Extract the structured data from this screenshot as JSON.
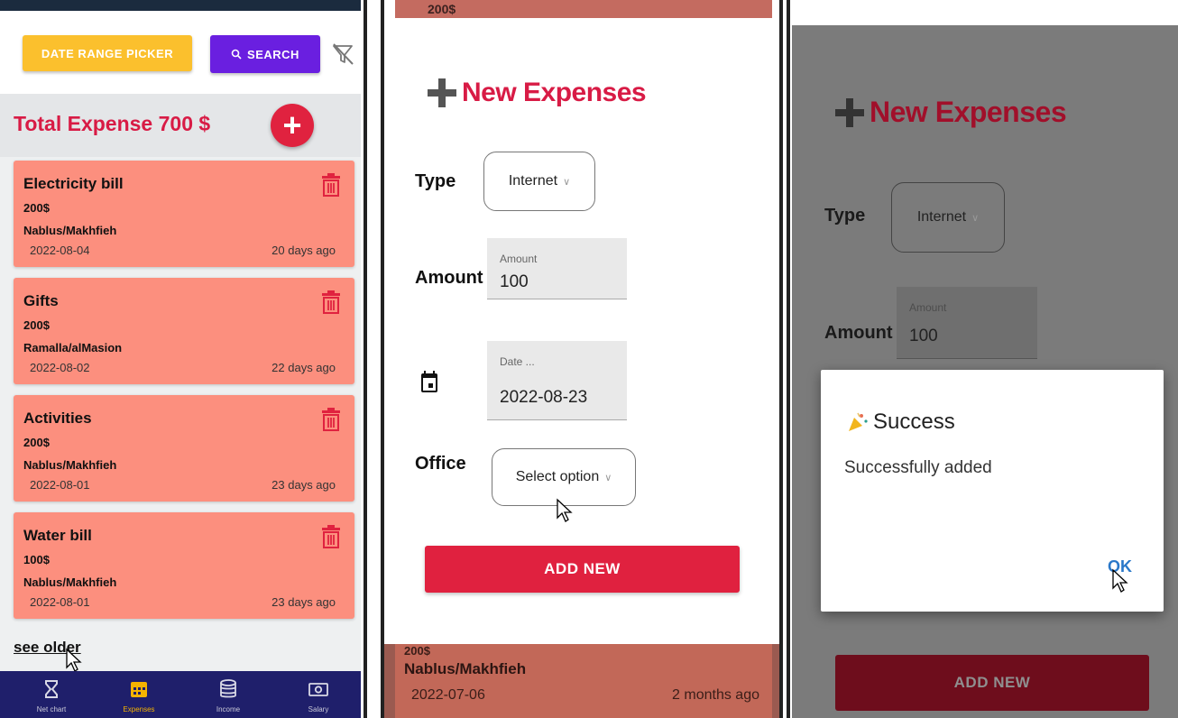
{
  "panel1": {
    "toolbar": {
      "date_range_label": "DATE RANGE PICKER",
      "search_label": "SEARCH"
    },
    "total_label": "Total Expense 700 $",
    "expenses": [
      {
        "title": "Electricity bill",
        "amount": "200$",
        "location": "Nablus/Makhfieh",
        "date": "2022-08-04",
        "ago": "20 days ago"
      },
      {
        "title": "Gifts",
        "amount": "200$",
        "location": "Ramalla/alMasion",
        "date": "2022-08-02",
        "ago": "22 days ago"
      },
      {
        "title": "Activities",
        "amount": "200$",
        "location": "Nablus/Makhfieh",
        "date": "2022-08-01",
        "ago": "23 days ago"
      },
      {
        "title": "Water bill",
        "amount": "100$",
        "location": "Nablus/Makhfieh",
        "date": "2022-08-01",
        "ago": "23 days ago"
      }
    ],
    "see_older": "see older",
    "nav": [
      {
        "label": "Net chart",
        "icon": "hourglass-icon"
      },
      {
        "label": "Expenses",
        "icon": "calendar-icon",
        "active": true
      },
      {
        "label": "Income",
        "icon": "database-icon"
      },
      {
        "label": "Salary",
        "icon": "money-icon"
      }
    ]
  },
  "panel2": {
    "bg_top_text": "200$",
    "title": "New Expenses",
    "type_label": "Type",
    "type_value": "Internet",
    "amount_label": "Amount",
    "amount_placeholder": "Amount",
    "amount_value": "100",
    "date_placeholder": "Date ...",
    "date_value": "2022-08-23",
    "office_label": "Office",
    "office_value": "Select option",
    "add_new_label": "ADD NEW",
    "bg_card": {
      "amount": "200$",
      "location": "Nablus/Makhfieh",
      "date": "2022-07-06",
      "ago": "2 months ago"
    }
  },
  "panel3": {
    "title": "New Expenses",
    "type_label": "Type",
    "type_value": "Internet",
    "amount_label": "Amount",
    "amount_placeholder": "Amount",
    "amount_value": "100",
    "success_title": "Success",
    "success_message": "Successfully added",
    "ok_label": "OK",
    "add_new_label": "ADD NEW"
  },
  "colors": {
    "accent_red": "#d81b45",
    "card_salmon": "#fc8f7e",
    "nav_bg": "#1f1f6b",
    "date_btn": "#fbc02d",
    "search_btn": "#6a1fe0"
  }
}
